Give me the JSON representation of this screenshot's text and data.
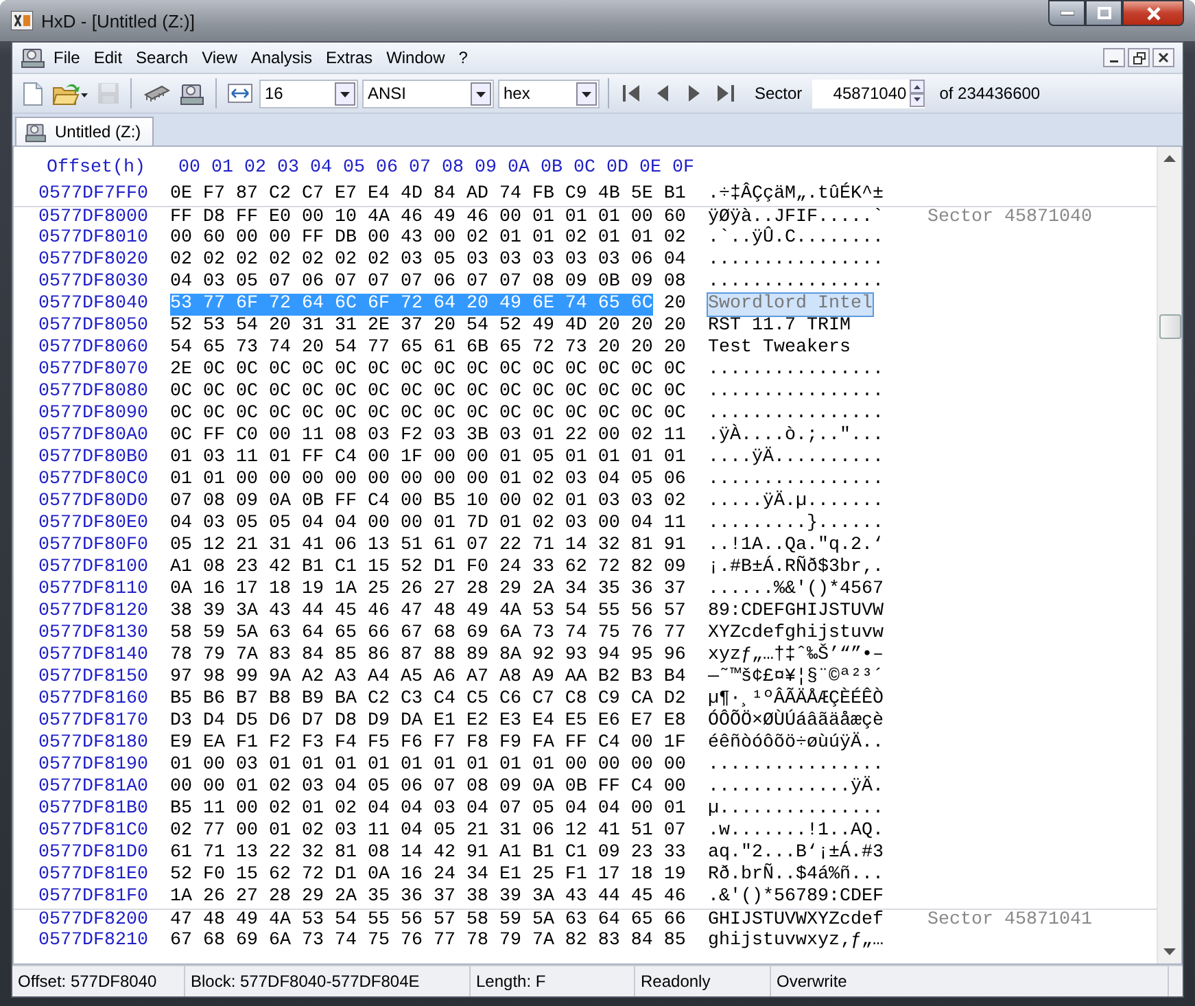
{
  "window": {
    "title": "HxD - [Untitled (Z:)]"
  },
  "menu": [
    "File",
    "Edit",
    "Search",
    "View",
    "Analysis",
    "Extras",
    "Window",
    "?"
  ],
  "toolbar": [
    {
      "kind": "new",
      "disabled": false
    },
    {
      "kind": "open",
      "disabled": false
    },
    {
      "kind": "save",
      "disabled": true
    },
    {
      "kind": "separator"
    },
    {
      "kind": "ram",
      "disabled": false
    },
    {
      "kind": "disk",
      "disabled": false
    },
    {
      "kind": "separator"
    },
    {
      "kind": "row-width",
      "disabled": false
    },
    {
      "kind": "combo",
      "value": "16"
    },
    {
      "kind": "combo",
      "value": "ANSI"
    },
    {
      "kind": "combo",
      "value": "hex"
    },
    {
      "kind": "separator"
    },
    {
      "kind": "first",
      "disabled": false
    },
    {
      "kind": "prev",
      "disabled": false
    },
    {
      "kind": "next",
      "disabled": false
    },
    {
      "kind": "last",
      "disabled": false
    },
    {
      "kind": "label",
      "text": "Sector"
    },
    {
      "kind": "spin",
      "value": "45871040"
    },
    {
      "kind": "label",
      "text": "of 234436600"
    }
  ],
  "tabs": [
    {
      "label": "Untitled (Z:)",
      "selected": true
    }
  ],
  "hex_view": {
    "offset_header": "Offset(h)",
    "columns": [
      "00",
      "01",
      "02",
      "03",
      "04",
      "05",
      "06",
      "07",
      "08",
      "09",
      "0A",
      "0B",
      "0C",
      "0D",
      "0E",
      "0F"
    ],
    "rows": [
      {
        "offset": "0577DF7FF0",
        "hex": "0E F7 87 C2 C7 E7 E4 4D 84 AD 74 FB C9 4B 5E B1",
        "text": ".÷‡ÂÇçäM„.tûÉK^±"
      },
      {
        "offset": "0577DF8000",
        "hex": "FF D8 FF E0 00 10 4A 46 49 46 00 01 01 01 00 60",
        "text": "ÿØÿà..JFIF.....`",
        "sector": "Sector 45871040"
      },
      {
        "offset": "0577DF8010",
        "hex": "00 60 00 00 FF DB 00 43 00 02 01 01 02 01 01 02",
        "text": ".`..ÿÛ.C........"
      },
      {
        "offset": "0577DF8020",
        "hex": "02 02 02 02 02 02 02 03 05 03 03 03 03 03 06 04",
        "text": "................"
      },
      {
        "offset": "0577DF8030",
        "hex": "04 03 05 07 06 07 07 07 06 07 07 08 09 0B 09 08",
        "text": "................"
      },
      {
        "offset": "0577DF8040",
        "hex_selected": "53 77 6F 72 64 6C 6F 72 64 20 49 6E 74 65 6C",
        "hex": "20",
        "text_selected": "Swordlord Intel"
      },
      {
        "offset": "0577DF8050",
        "hex": "52 53 54 20 31 31 2E 37 20 54 52 49 4D 20 20 20",
        "text": "RST 11.7 TRIM"
      },
      {
        "offset": "0577DF8060",
        "hex": "54 65 73 74 20 54 77 65 61 6B 65 72 73 20 20 20",
        "text": "Test Tweakers"
      },
      {
        "offset": "0577DF8070",
        "hex": "2E 0C 0C 0C 0C 0C 0C 0C 0C 0C 0C 0C 0C 0C 0C 0C",
        "text": "................"
      },
      {
        "offset": "0577DF8080",
        "hex": "0C 0C 0C 0C 0C 0C 0C 0C 0C 0C 0C 0C 0C 0C 0C 0C",
        "text": "................"
      },
      {
        "offset": "0577DF8090",
        "hex": "0C 0C 0C 0C 0C 0C 0C 0C 0C 0C 0C 0C 0C 0C 0C 0C",
        "text": "................"
      },
      {
        "offset": "0577DF80A0",
        "hex": "0C FF C0 00 11 08 03 F2 03 3B 03 01 22 00 02 11",
        "text": ".ÿÀ....ò.;..\"..."
      },
      {
        "offset": "0577DF80B0",
        "hex": "01 03 11 01 FF C4 00 1F 00 00 01 05 01 01 01 01",
        "text": "....ÿÄ.........."
      },
      {
        "offset": "0577DF80C0",
        "hex": "01 01 00 00 00 00 00 00 00 00 01 02 03 04 05 06",
        "text": "................"
      },
      {
        "offset": "0577DF80D0",
        "hex": "07 08 09 0A 0B FF C4 00 B5 10 00 02 01 03 03 02",
        "text": ".....ÿÄ.µ......."
      },
      {
        "offset": "0577DF80E0",
        "hex": "04 03 05 05 04 04 00 00 01 7D 01 02 03 00 04 11",
        "text": ".........}......"
      },
      {
        "offset": "0577DF80F0",
        "hex": "05 12 21 31 41 06 13 51 61 07 22 71 14 32 81 91",
        "text": "..!1A..Qa.\"q.2.‘"
      },
      {
        "offset": "0577DF8100",
        "hex": "A1 08 23 42 B1 C1 15 52 D1 F0 24 33 62 72 82 09",
        "text": "¡.#B±Á.RÑð$3br‚."
      },
      {
        "offset": "0577DF8110",
        "hex": "0A 16 17 18 19 1A 25 26 27 28 29 2A 34 35 36 37",
        "text": "......%&'()*4567"
      },
      {
        "offset": "0577DF8120",
        "hex": "38 39 3A 43 44 45 46 47 48 49 4A 53 54 55 56 57",
        "text": "89:CDEFGHIJSTUVW"
      },
      {
        "offset": "0577DF8130",
        "hex": "58 59 5A 63 64 65 66 67 68 69 6A 73 74 75 76 77",
        "text": "XYZcdefghijstuvw"
      },
      {
        "offset": "0577DF8140",
        "hex": "78 79 7A 83 84 85 86 87 88 89 8A 92 93 94 95 96",
        "text": "xyzƒ„…†‡ˆ‰Š’“”•–"
      },
      {
        "offset": "0577DF8150",
        "hex": "97 98 99 9A A2 A3 A4 A5 A6 A7 A8 A9 AA B2 B3 B4",
        "text": "—˜™š¢£¤¥¦§¨©ª²³´"
      },
      {
        "offset": "0577DF8160",
        "hex": "B5 B6 B7 B8 B9 BA C2 C3 C4 C5 C6 C7 C8 C9 CA D2",
        "text": "µ¶·¸¹ºÂÃÄÅÆÇÈÉÊÒ"
      },
      {
        "offset": "0577DF8170",
        "hex": "D3 D4 D5 D6 D7 D8 D9 DA E1 E2 E3 E4 E5 E6 E7 E8",
        "text": "ÓÔÕÖ×ØÙÚáâãäåæçè"
      },
      {
        "offset": "0577DF8180",
        "hex": "E9 EA F1 F2 F3 F4 F5 F6 F7 F8 F9 FA FF C4 00 1F",
        "text": "éêñòóôõö÷øùúÿÄ.."
      },
      {
        "offset": "0577DF8190",
        "hex": "01 00 03 01 01 01 01 01 01 01 01 01 00 00 00 00",
        "text": "................"
      },
      {
        "offset": "0577DF81A0",
        "hex": "00 00 01 02 03 04 05 06 07 08 09 0A 0B FF C4 00",
        "text": ".............ÿÄ."
      },
      {
        "offset": "0577DF81B0",
        "hex": "B5 11 00 02 01 02 04 04 03 04 07 05 04 04 00 01",
        "text": "µ..............."
      },
      {
        "offset": "0577DF81C0",
        "hex": "02 77 00 01 02 03 11 04 05 21 31 06 12 41 51 07",
        "text": ".w.......!1..AQ."
      },
      {
        "offset": "0577DF81D0",
        "hex": "61 71 13 22 32 81 08 14 42 91 A1 B1 C1 09 23 33",
        "text": "aq.\"2...B‘¡±Á.#3"
      },
      {
        "offset": "0577DF81E0",
        "hex": "52 F0 15 62 72 D1 0A 16 24 34 E1 25 F1 17 18 19",
        "text": "Rð.brÑ..$4á%ñ..."
      },
      {
        "offset": "0577DF81F0",
        "hex": "1A 26 27 28 29 2A 35 36 37 38 39 3A 43 44 45 46",
        "text": ".&'()*56789:CDEF"
      },
      {
        "offset": "0577DF8200",
        "hex": "47 48 49 4A 53 54 55 56 57 58 59 5A 63 64 65 66",
        "text": "GHIJSTUVWXYZcdef",
        "sector": "Sector 45871041"
      },
      {
        "offset": "0577DF8210",
        "hex": "67 68 69 6A 73 74 75 76 77 78 79 7A 82 83 84 85",
        "text": "ghijstuvwxyz‚ƒ„…"
      }
    ]
  },
  "status_bar": [
    "Offset: 577DF8040",
    "Block: 577DF8040-577DF804E",
    "Length: F",
    "Readonly",
    "Overwrite"
  ]
}
